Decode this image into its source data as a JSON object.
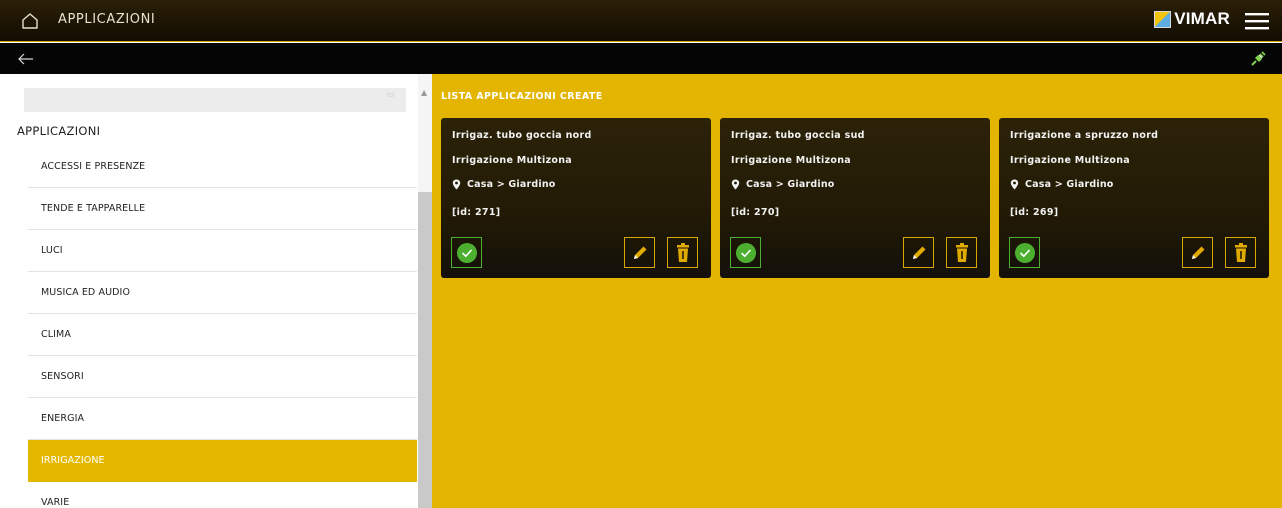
{
  "header": {
    "title": "APPLICAZIONI",
    "brand": "VIMAR"
  },
  "sidebar": {
    "search_placeholder": "",
    "section_label": "APPLICAZIONI",
    "items": [
      {
        "label": "ACCESSI E PRESENZE",
        "active": false
      },
      {
        "label": "TENDE E TAPPARELLE",
        "active": false
      },
      {
        "label": "LUCI",
        "active": false
      },
      {
        "label": "MUSICA ED AUDIO",
        "active": false
      },
      {
        "label": "CLIMA",
        "active": false
      },
      {
        "label": "SENSORI",
        "active": false
      },
      {
        "label": "ENERGIA",
        "active": false
      },
      {
        "label": "IRRIGAZIONE",
        "active": true
      },
      {
        "label": "VARIE",
        "active": false
      }
    ]
  },
  "main": {
    "title": "LISTA APPLICAZIONI CREATE",
    "cards": [
      {
        "name": "Irrigaz. tubo goccia nord",
        "type": "Irrigazione Multizona",
        "location": "Casa > Giardino",
        "id": "[id: 271]"
      },
      {
        "name": "Irrigaz. tubo goccia sud",
        "type": "Irrigazione Multizona",
        "location": "Casa > Giardino",
        "id": "[id: 270]"
      },
      {
        "name": "Irrigazione a spruzzo nord",
        "type": "Irrigazione Multizona",
        "location": "Casa > Giardino",
        "id": "[id: 269]"
      }
    ]
  },
  "colors": {
    "accent": "#e3b500",
    "header_bg": "#1e1605",
    "card_bg": "#241b06",
    "check_green": "#4caf30",
    "active_item": "#e5b800"
  },
  "icons": {
    "home": "home-icon",
    "menu": "hamburger-menu-icon",
    "back": "arrow-left-icon",
    "connection": "plug-icon",
    "location": "map-pin-icon",
    "enabled": "check-circle-icon",
    "edit": "pencil-icon",
    "delete": "trash-icon"
  }
}
